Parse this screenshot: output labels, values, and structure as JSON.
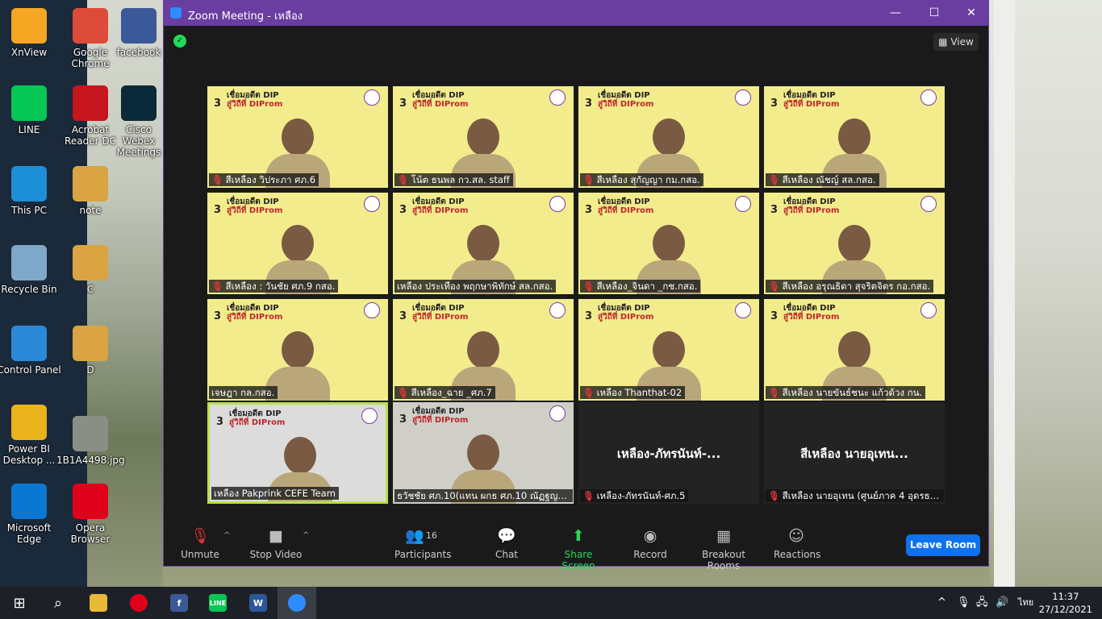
{
  "desktop": {
    "icons": [
      {
        "label": "XnView",
        "color": "#f5a623"
      },
      {
        "label": "Google Chrome",
        "color": "#dd4b39"
      },
      {
        "label": "facebook",
        "color": "#3b5998"
      },
      {
        "label": "LINE",
        "color": "#06c755"
      },
      {
        "label": "Acrobat Reader DC",
        "color": "#c4161c"
      },
      {
        "label": "Cisco Webex Meetings",
        "color": "#0a2a3a"
      },
      {
        "label": "This PC",
        "color": "#1c8fd6"
      },
      {
        "label": "note",
        "color": "#d9a441"
      },
      {
        "label": "Recycle Bin",
        "color": "#7fa7c9"
      },
      {
        "label": "C",
        "color": "#d9a441"
      },
      {
        "label": "Control Panel",
        "color": "#2b88d8"
      },
      {
        "label": "D",
        "color": "#d9a441"
      },
      {
        "label": "Power BI Desktop ...",
        "color": "#e8b31c"
      },
      {
        "label": "1B1A4498.jpg",
        "color": "#8a8f86"
      },
      {
        "label": "Microsoft Edge",
        "color": "#0c77d0"
      },
      {
        "label": "Opera Browser",
        "color": "#e0001b"
      }
    ]
  },
  "window": {
    "title": "Zoom Meeting - เหลือง",
    "minimize": "—",
    "maximize": "☐",
    "close": "✕",
    "view_label": "View",
    "accent": "#6a3ea1"
  },
  "banner": {
    "line1": "เชื่อมอดีต DIP",
    "line2": "สู่วิถีที่ DIProm",
    "num": "3"
  },
  "tiles": [
    {
      "name": "สีเหลือง วิประภา ศภ.6",
      "muted": true
    },
    {
      "name": "โน้ต ธนพล กว.สล. staff",
      "muted": true
    },
    {
      "name": "สีเหลือง สุกัญญา กม.กสอ.",
      "muted": true
    },
    {
      "name": "สีเหลือง ณัชญ์ สล.กสอ.",
      "muted": true
    },
    {
      "name": "สีเหลือง : วันชัย ศภ.9 กสอ.",
      "muted": true
    },
    {
      "name": "เหลือง ประเทือง พฤกษาพิทักษ์ สล.กสอ.",
      "muted": false
    },
    {
      "name": "สีเหลือง_จินดา _กช.กสอ.",
      "muted": true
    },
    {
      "name": "สีเหลือง อรุณธิดา สุจริตจิตร กอ.กสอ.",
      "muted": true
    },
    {
      "name": "เจษฎา กล.กสอ.",
      "muted": false
    },
    {
      "name": "สีเหลือง_ฉาย _ศภ.7",
      "muted": true
    },
    {
      "name": "เหลือง Thanthat-02",
      "muted": true
    },
    {
      "name": "สีเหลือง นายขันธ์ชนะ แก้วด้วง กน.",
      "muted": true
    },
    {
      "name": "เหลือง Pakprink CEFE Team",
      "muted": false
    },
    {
      "name": "ธวัชชัย ศภ.10(แทน ผกธ ศภ.10 ณัฏฐญา ...",
      "muted": false
    },
    {
      "name": "เหลือง-ภัทรนันท์-ศภ.5",
      "muted": true,
      "big": "เหลือง-ภัทรนันท์-..."
    },
    {
      "name": "สีเหลือง นายอุเทน (ศูนย์ภาค 4 อุดรธานี)",
      "muted": true,
      "big": "สีเหลือง นายอุเทน..."
    }
  ],
  "toolbar": {
    "unmute": "Unmute",
    "stop_video": "Stop Video",
    "participants": "Participants",
    "participant_count": "16",
    "chat": "Chat",
    "share_screen": "Share Screen",
    "record": "Record",
    "breakout_rooms": "Breakout Rooms",
    "reactions": "Reactions",
    "leave": "Leave Room"
  },
  "taskbar": {
    "lang": "ไทย",
    "time": "11:37",
    "date": "27/12/2021"
  }
}
